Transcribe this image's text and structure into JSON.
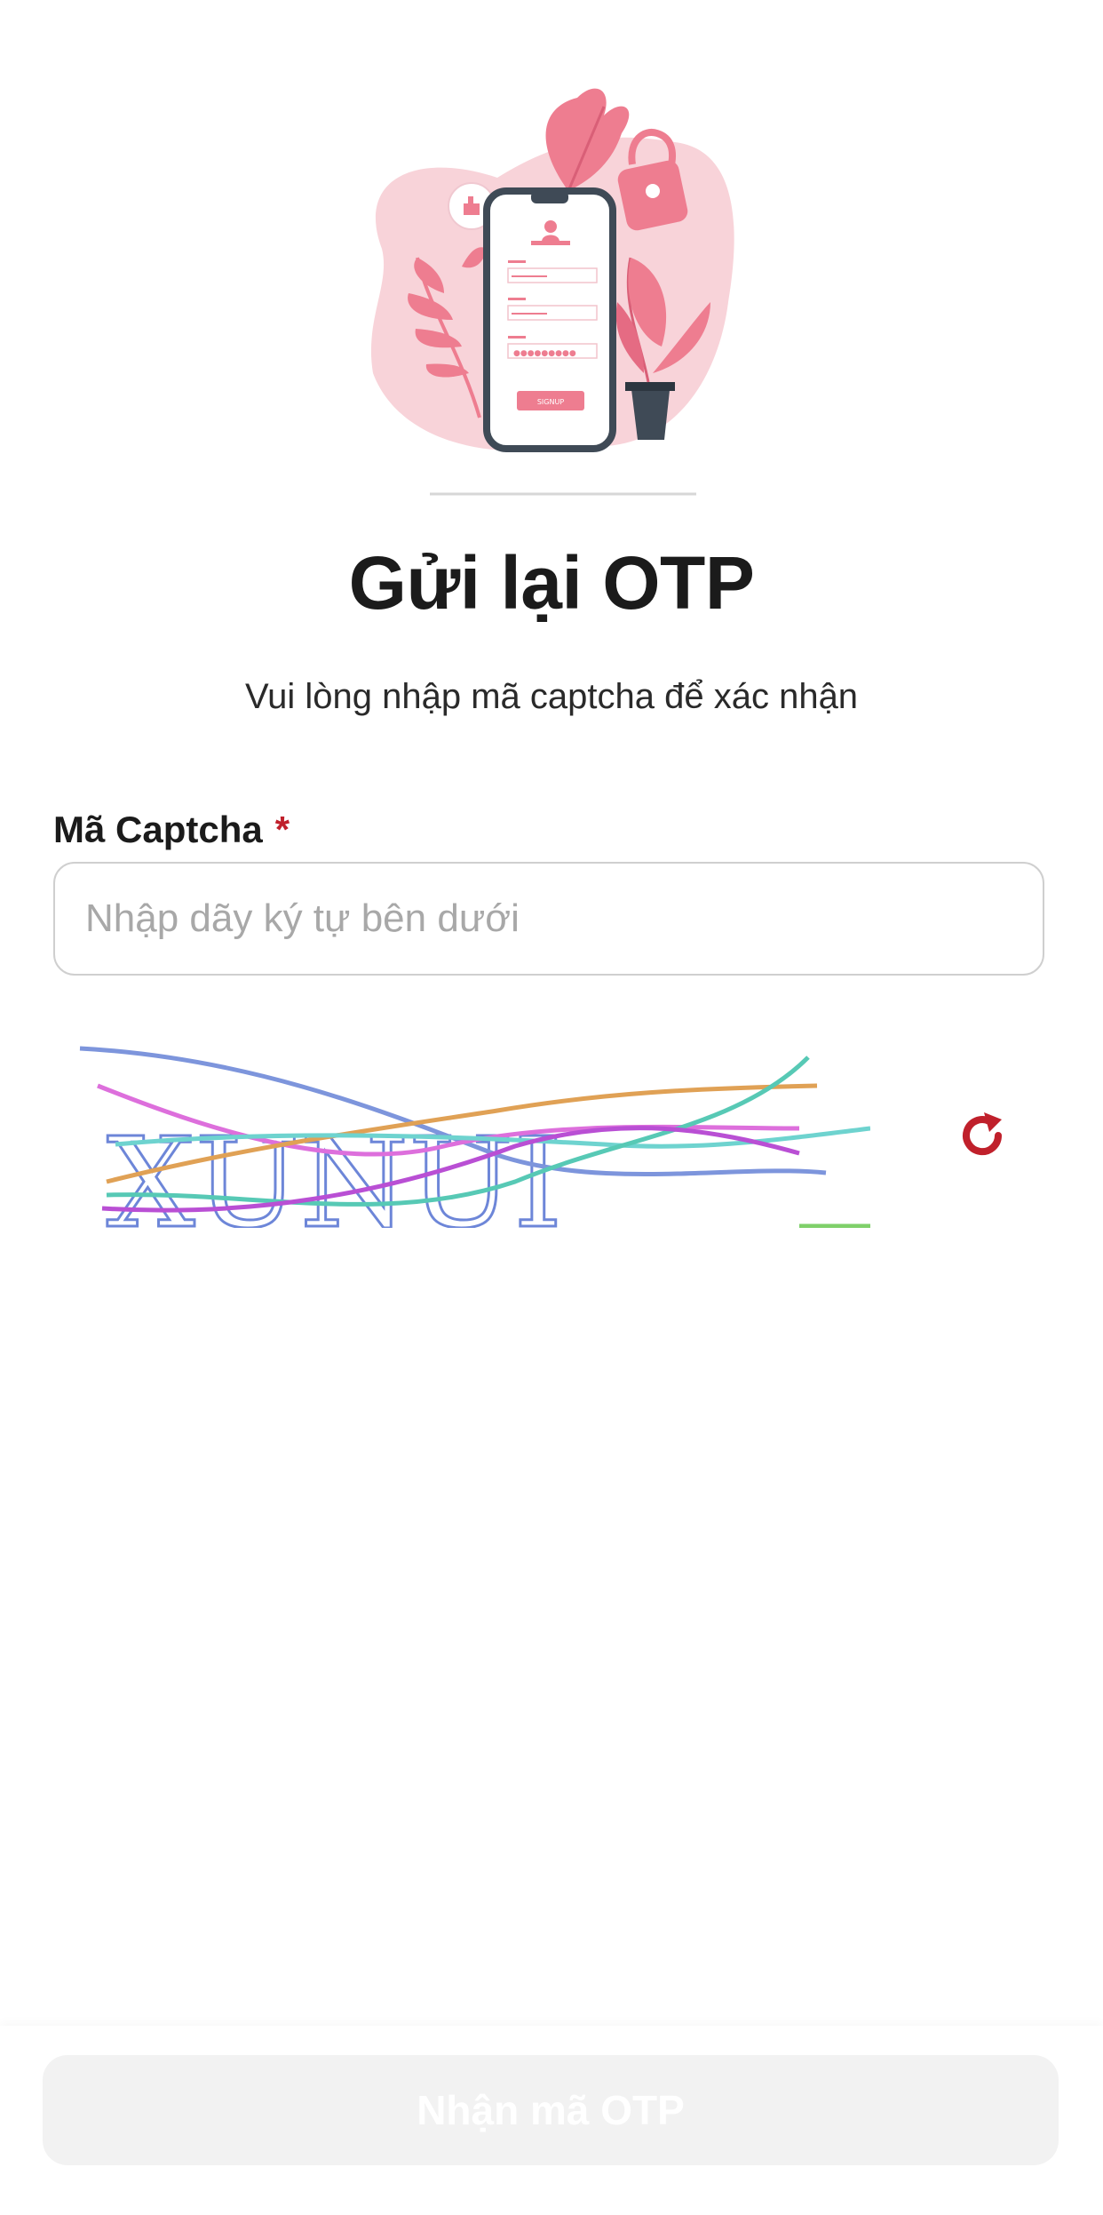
{
  "page": {
    "title": "Gửi lại OTP",
    "subtitle": "Vui lòng nhập mã captcha để xác nhận"
  },
  "illustration": {
    "name": "phone-signup-illustration",
    "button_text": "SIGNUP"
  },
  "captcha": {
    "label": "Mã Captcha",
    "required_mark": "*",
    "placeholder": "Nhập dãy ký tự bên dưới",
    "value": "",
    "image_text": "XUNUI",
    "refresh_icon": "refresh-icon"
  },
  "footer": {
    "submit_label": "Nhận mã OTP"
  },
  "colors": {
    "accent": "#c0202b",
    "pink": "#ee7d90",
    "button_disabled_bg": "#f2f2f2"
  }
}
